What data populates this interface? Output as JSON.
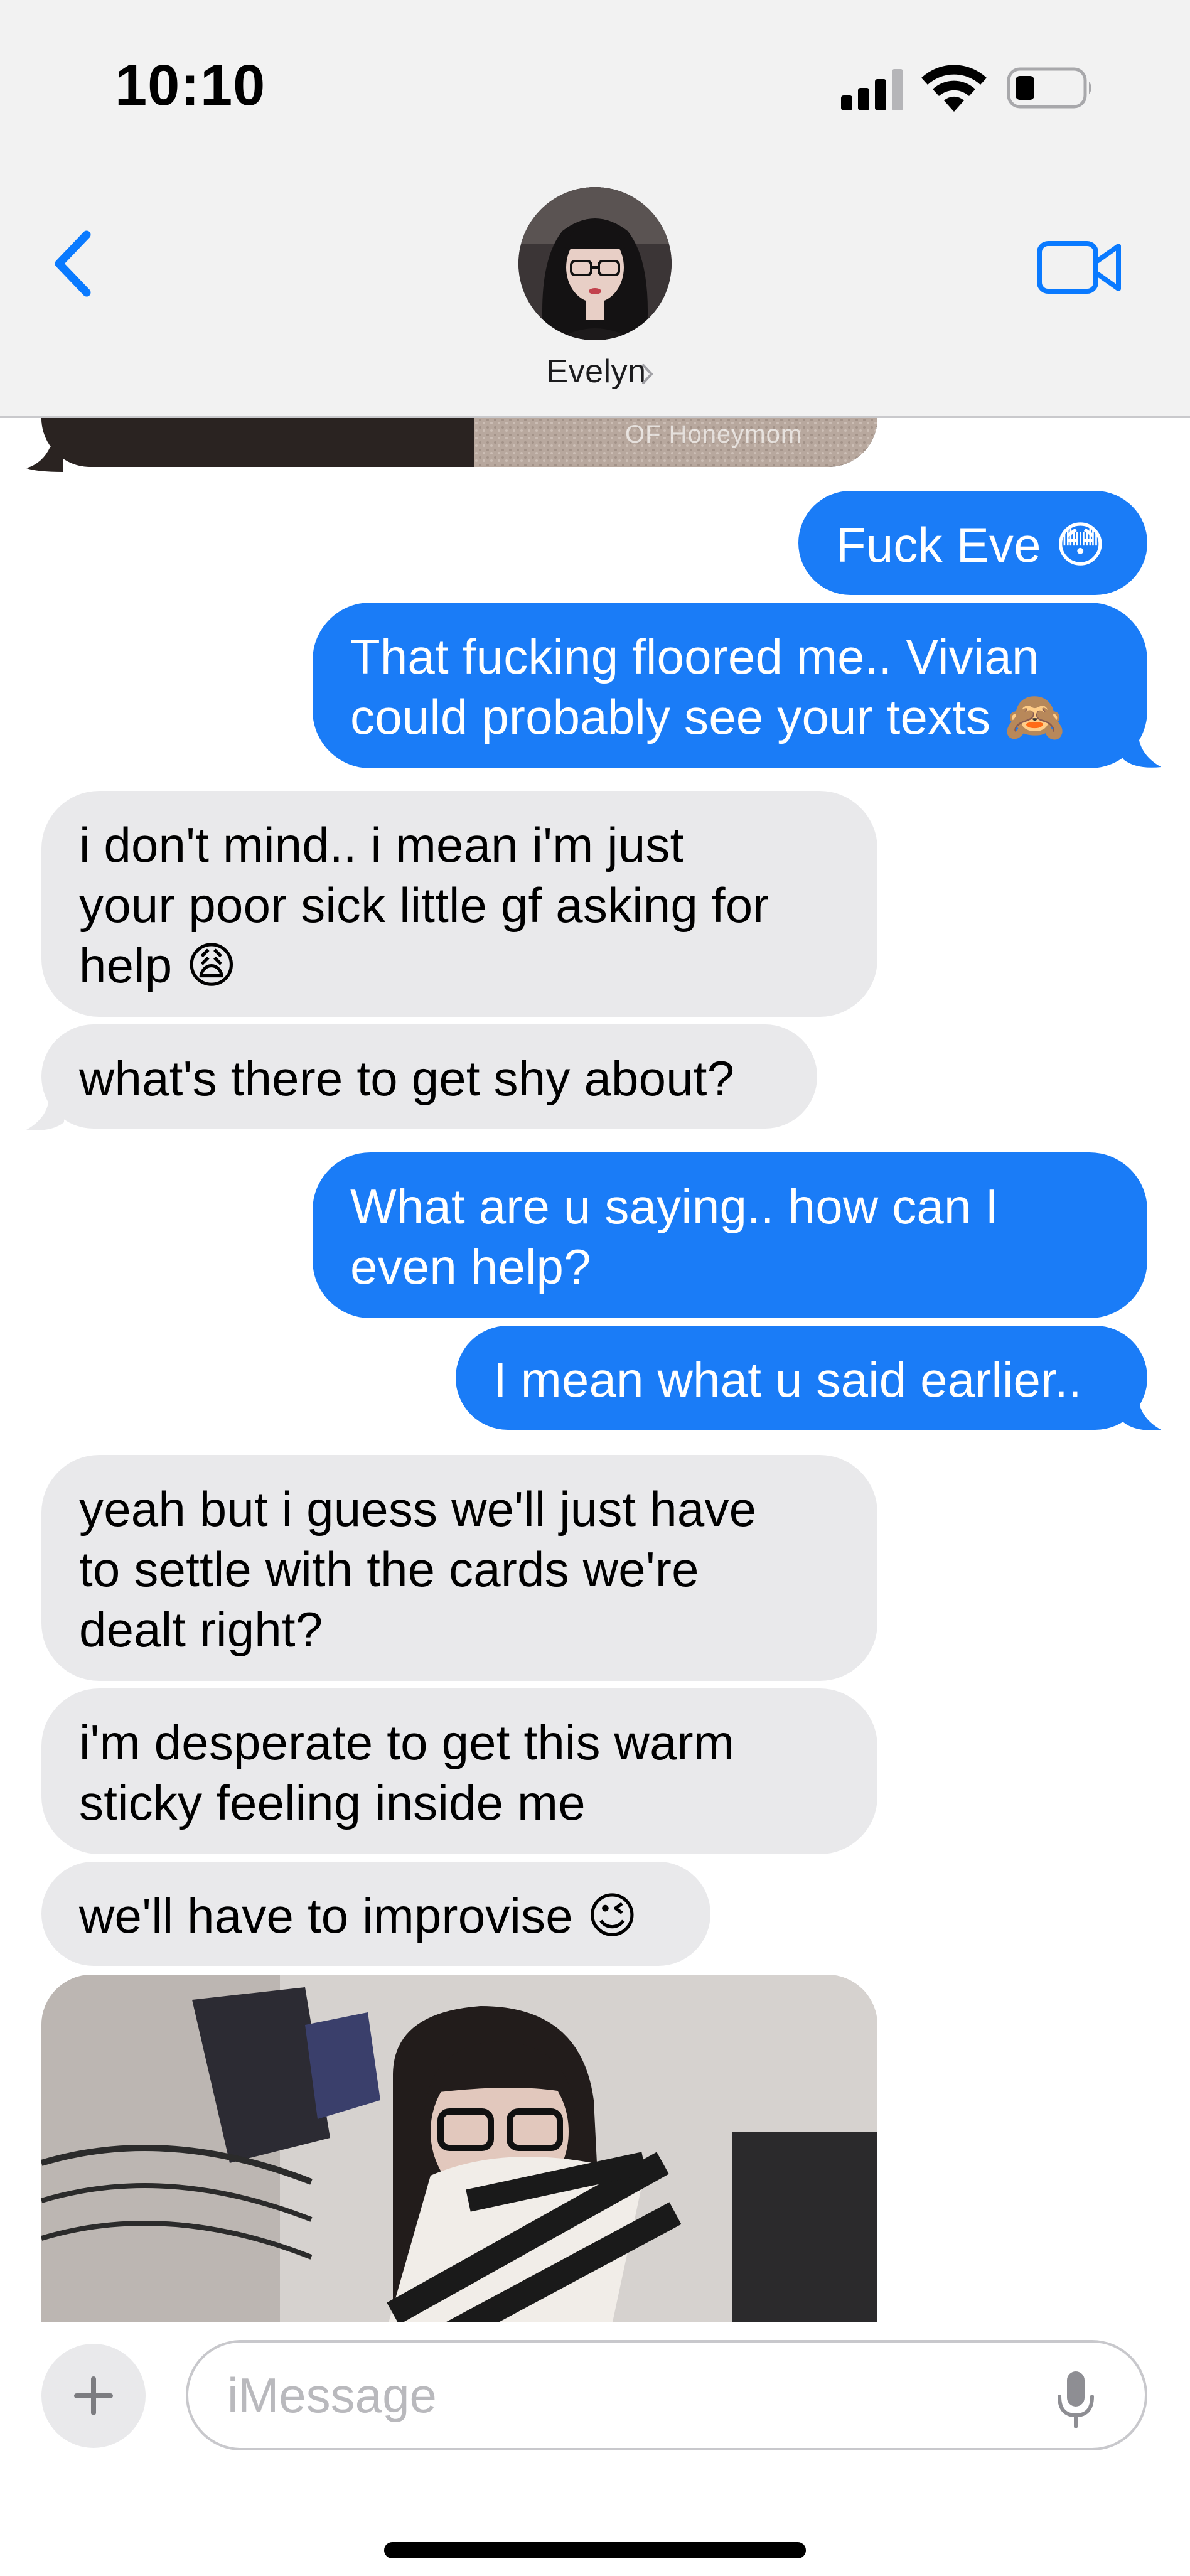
{
  "status_bar": {
    "time": "10:10"
  },
  "header": {
    "contact_name": "Evelyn",
    "back_icon": "chevron-left-icon",
    "video_icon": "video-camera-icon"
  },
  "photo_top": {
    "watermark": "OF Honeymom"
  },
  "messages": [
    {
      "sender": "me",
      "text": "Fuck Eve 😳"
    },
    {
      "sender": "me",
      "text": "That fucking floored me.. Vivian\ncould probably see your texts 🙈"
    },
    {
      "sender": "them",
      "text": "i don't mind.. i mean i'm just\nyour poor sick little gf asking for\nhelp 😩"
    },
    {
      "sender": "them",
      "text": "what's there to get shy about?"
    },
    {
      "sender": "me",
      "text": "What are u saying.. how can I\neven help?"
    },
    {
      "sender": "me",
      "text": "I mean what u said earlier.."
    },
    {
      "sender": "them",
      "text": "yeah but i guess we'll just have\nto settle with the cards we're\ndealt right?"
    },
    {
      "sender": "them",
      "text": "i'm desperate to get this warm\nsticky feeling inside me"
    },
    {
      "sender": "them",
      "text": "we'll have to improvise 😉"
    }
  ],
  "composer": {
    "placeholder": "iMessage",
    "plus_icon": "plus-icon",
    "mic_icon": "microphone-icon"
  },
  "colors": {
    "outgoing_bubble": "#1a7cf7",
    "incoming_bubble": "#e9e9eb",
    "accent": "#0a7aff"
  }
}
